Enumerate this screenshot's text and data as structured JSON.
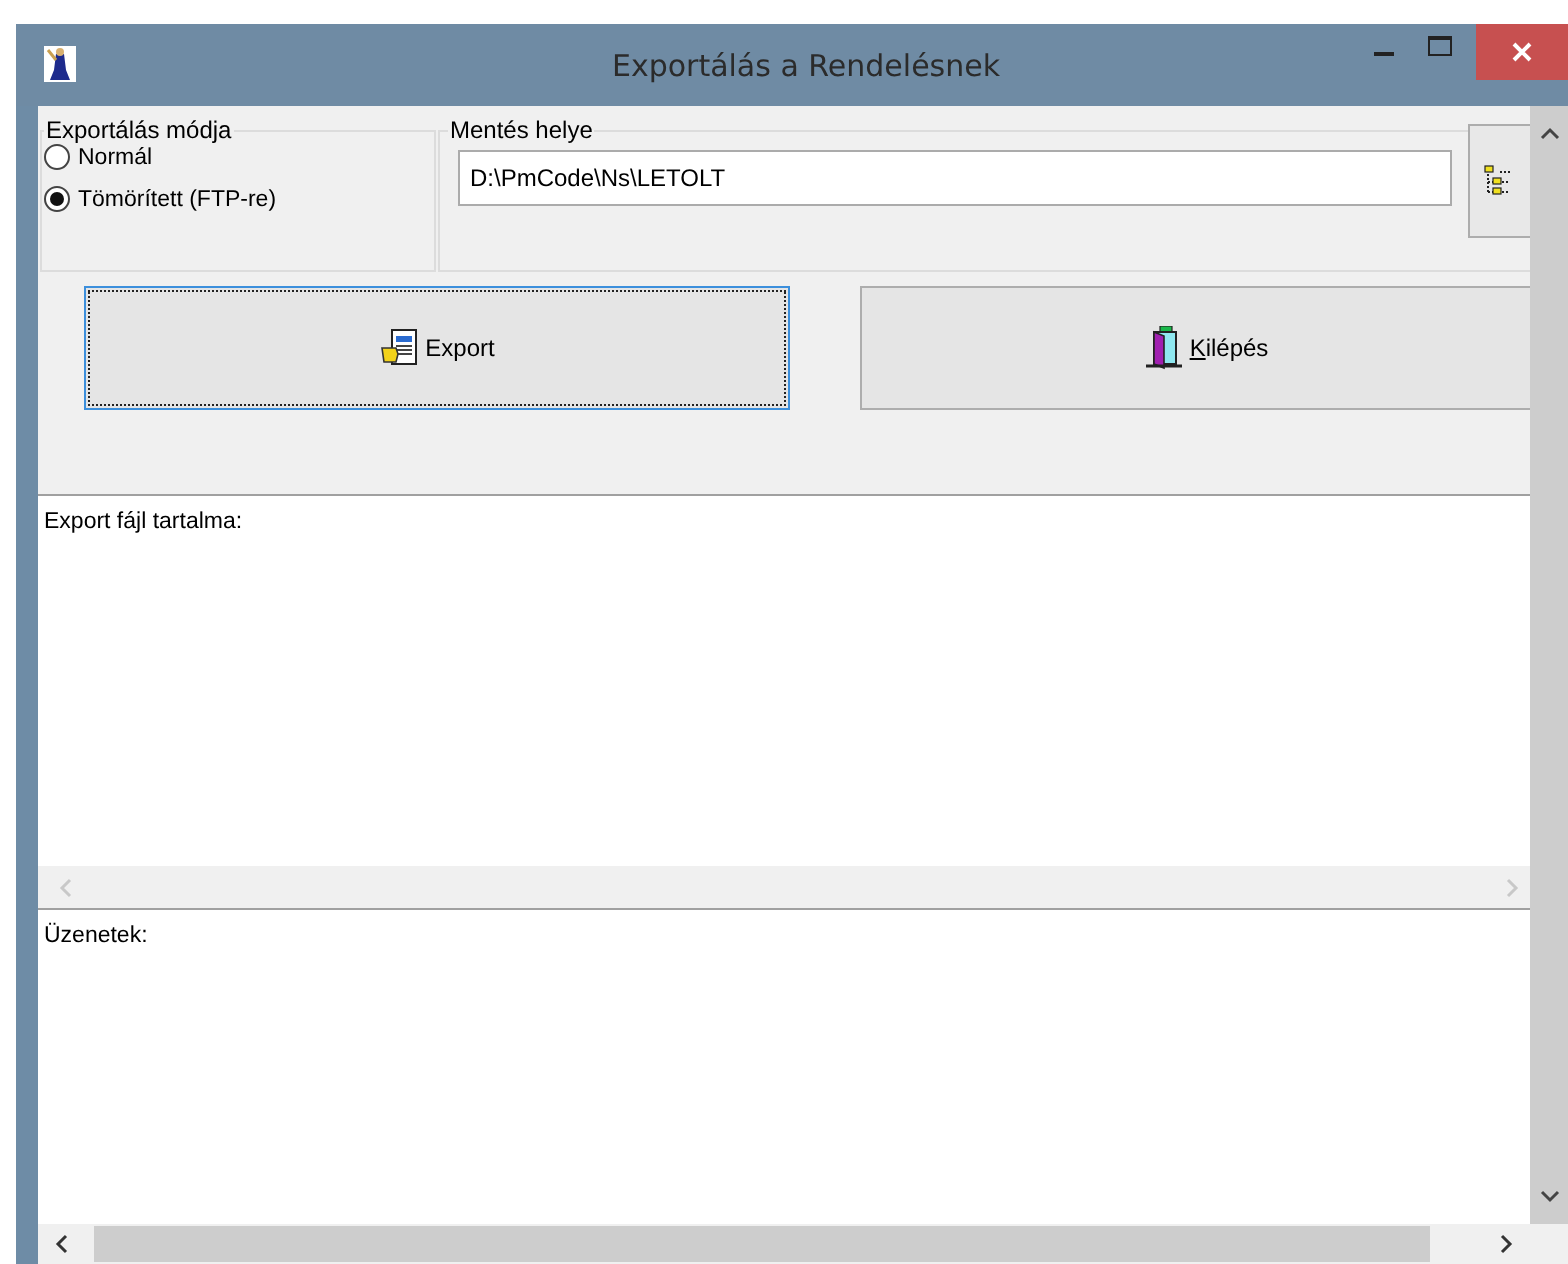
{
  "window": {
    "title": "Exportálás a Rendelésnek"
  },
  "export_mode": {
    "label": "Exportálás módja",
    "options": [
      {
        "label": "Normál",
        "selected": false
      },
      {
        "label": "Tömörített (FTP-re)",
        "selected": true
      }
    ]
  },
  "save_location": {
    "label": "Mentés helye",
    "value": "D:\\PmCode\\Ns\\LETOLT"
  },
  "buttons": [
    {
      "label": "Export",
      "kind": "export",
      "focused": true,
      "underline_first": false
    },
    {
      "label": "Kilépés",
      "kind": "exit",
      "focused": false,
      "underline_first": true
    }
  ],
  "export_file": {
    "label": "Export fájl tartalma:"
  },
  "messages": {
    "label": "Üzenetek:"
  }
}
